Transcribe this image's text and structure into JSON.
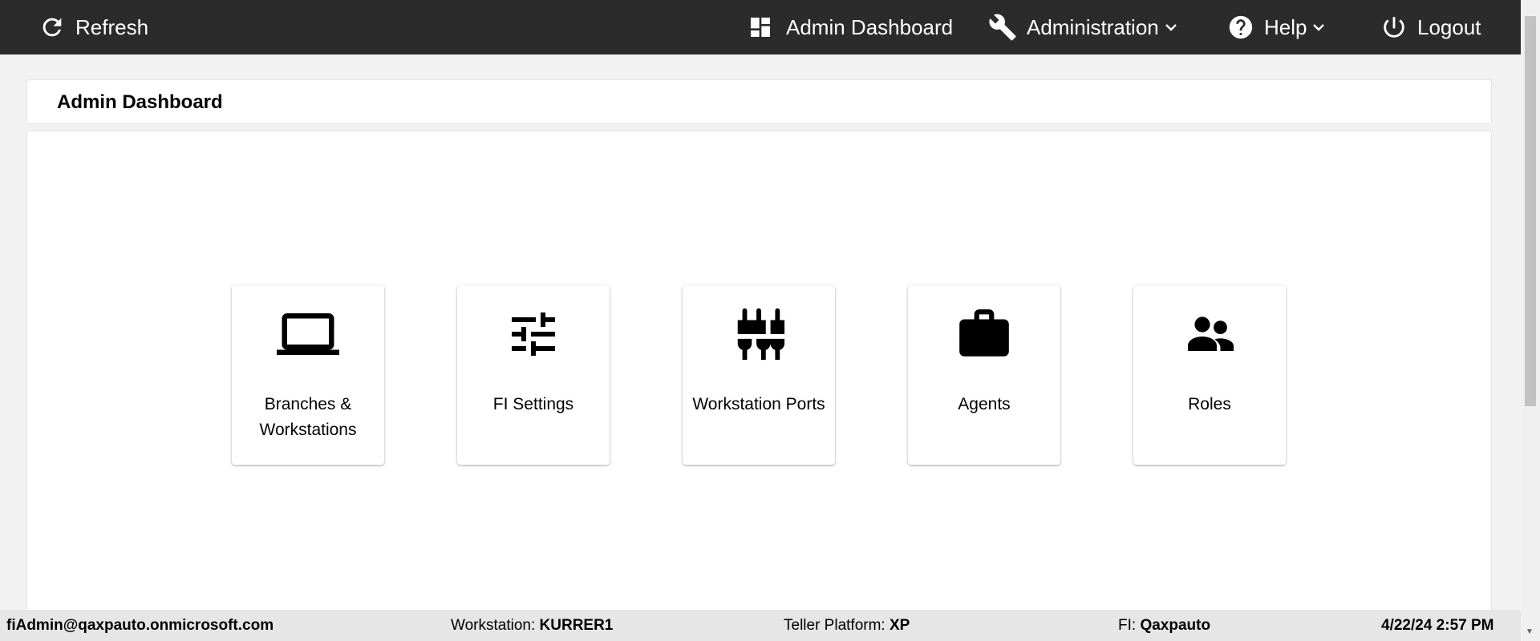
{
  "topbar": {
    "refresh": {
      "label": "Refresh",
      "icon": "refresh-icon"
    },
    "admin_dashboard": {
      "label": "Admin Dashboard",
      "icon": "dashboard-icon"
    },
    "administration": {
      "label": "Administration",
      "icon": "wrench-icon"
    },
    "help": {
      "label": "Help",
      "icon": "help-icon"
    },
    "logout": {
      "label": "Logout",
      "icon": "power-icon"
    }
  },
  "page": {
    "title": "Admin Dashboard"
  },
  "tiles": [
    {
      "label_line1": "Branches &",
      "label_line2": "Workstations",
      "icon": "laptop-icon"
    },
    {
      "label_line1": "FI Settings",
      "icon": "sliders-icon"
    },
    {
      "label_line1": "Workstation Ports",
      "icon": "ports-icon"
    },
    {
      "label_line1": "Agents",
      "icon": "briefcase-icon"
    },
    {
      "label_line1": "Roles",
      "icon": "people-icon"
    }
  ],
  "status": {
    "user": "fiAdmin@qaxpauto.onmicrosoft.com",
    "workstation_label": "Workstation:",
    "workstation_value": "KURRER1",
    "teller_platform_label": "Teller Platform:",
    "teller_platform_value": "XP",
    "fi_label": "FI:",
    "fi_value": "Qaxpauto",
    "datetime": "4/22/24 2:57 PM"
  },
  "colors": {
    "topbar_bg": "#2b2b2b",
    "page_bg": "#f2f2f2",
    "statusbar_bg": "#e6e6e6"
  }
}
